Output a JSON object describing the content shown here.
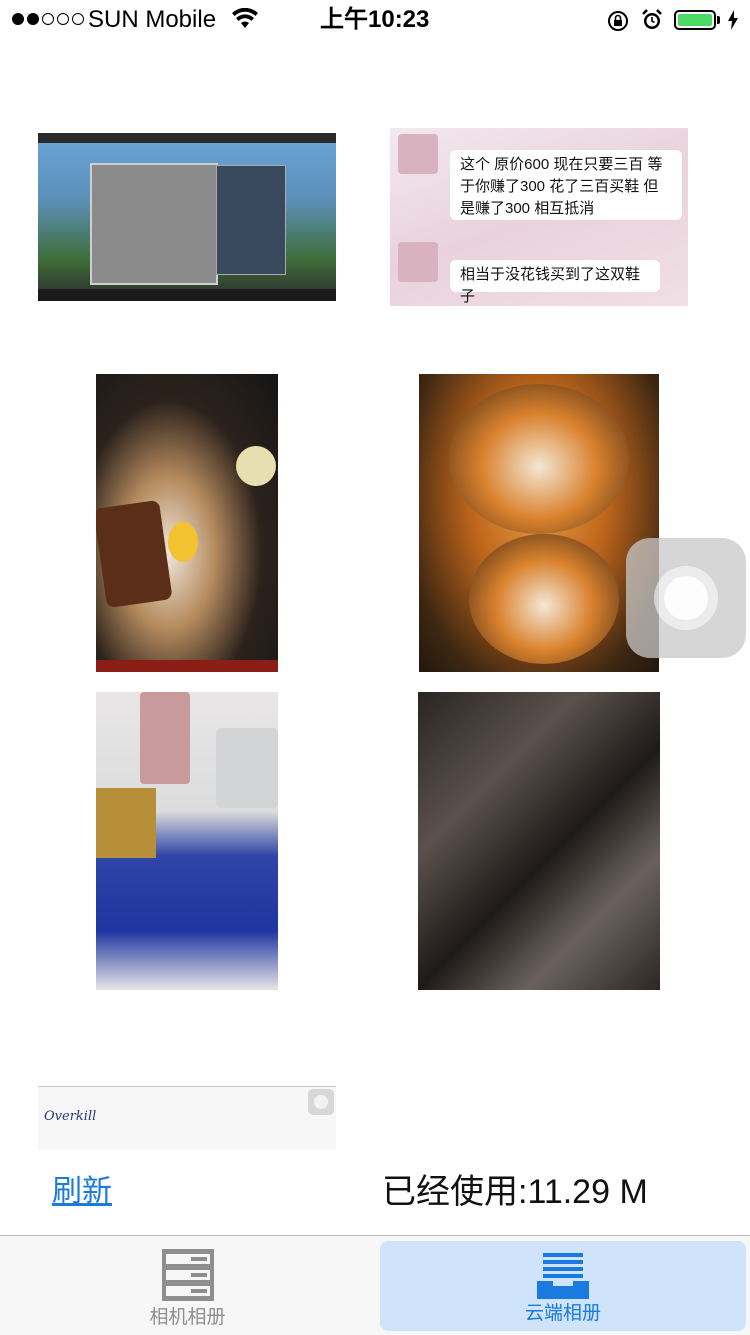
{
  "status_bar": {
    "carrier": "SUN Mobile",
    "time": "上午10:23",
    "signal_bars": 2,
    "signal_max": 5,
    "battery_level": 1.0,
    "battery_color": "#4cd964",
    "icons": [
      "wifi-icon",
      "rotation-lock-icon",
      "alarm-icon",
      "charging-icon"
    ]
  },
  "photos": {
    "chat_message_1": "这个 原价600 现在只要三百 等于你赚了300 花了三百买鞋 但是赚了300 相互抵消",
    "chat_message_2": "相当于没花钱买到了这双鞋子",
    "overkill_logo": "Overkill"
  },
  "footer": {
    "refresh_label": "刷新",
    "usage_text": "已经使用:11.29 M",
    "link_color": "#1a7ae0"
  },
  "tabbar": {
    "tabs": [
      {
        "label": "相机相册",
        "icon": "server-stack-icon",
        "selected": false,
        "color": "#8e8e8e"
      },
      {
        "label": "云端相册",
        "icon": "cloud-inbox-icon",
        "selected": true,
        "color": "#1a7ae0"
      }
    ],
    "selected_bg": "#cfe3fa"
  }
}
